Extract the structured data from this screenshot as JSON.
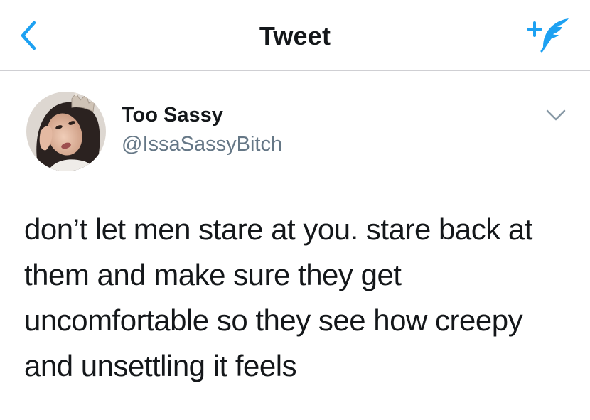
{
  "header": {
    "title": "Tweet",
    "back_icon": "chevron-left-icon",
    "compose_icon": "compose-tweet-icon"
  },
  "tweet": {
    "author_name": "Too Sassy",
    "author_handle": "@IssaSassyBitch",
    "text": "don’t let men stare at you. stare back at them and make sure they get uncomfortable so they see how creepy and unsettling it feels",
    "menu_icon": "chevron-down-icon"
  },
  "colors": {
    "accent": "#1da1f2",
    "text_primary": "#14171a",
    "text_secondary": "#657786",
    "divider": "#cfcfd3",
    "caret": "#8899a6"
  }
}
